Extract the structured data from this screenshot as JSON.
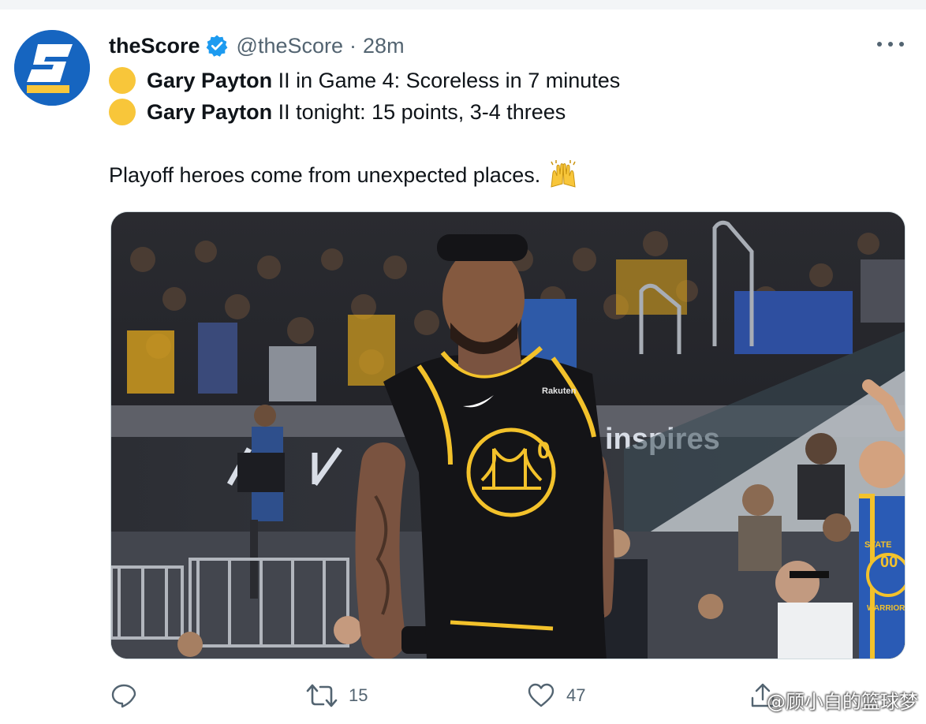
{
  "tweet": {
    "author": {
      "display_name": "theScore",
      "handle": "@theScore",
      "verified": true,
      "avatar_letter": "S"
    },
    "separator": "·",
    "time": "28m",
    "lines": [
      {
        "emoji": "yellow-circle",
        "player": "Gary Payton",
        "rest": " II in Game 4: Scoreless in 7 minutes"
      },
      {
        "emoji": "yellow-circle",
        "player": "Gary Payton",
        "rest": " II tonight: 15 points, 3-4 threes"
      }
    ],
    "body": "Playoff heroes come from unexpected places.",
    "body_emoji": "raising-hands",
    "media": {
      "jersey_number": "0",
      "jersey_brand": "Rakuten",
      "arena_signage": "inspires",
      "fan_jersey_number": "00",
      "fan_jersey_text": "STATE",
      "fan_jersey_text_2": "WARRIORS"
    },
    "actions": {
      "reply_count": "",
      "retweet_count": "15",
      "like_count": "47"
    }
  },
  "watermark": "@顾小白的篮球梦",
  "colors": {
    "accent_blue": "#1d9bf0",
    "avatar_blue": "#1665c0",
    "muted": "#536471",
    "yellow": "#f8c63a",
    "warriors_gold": "#f3c22b"
  }
}
